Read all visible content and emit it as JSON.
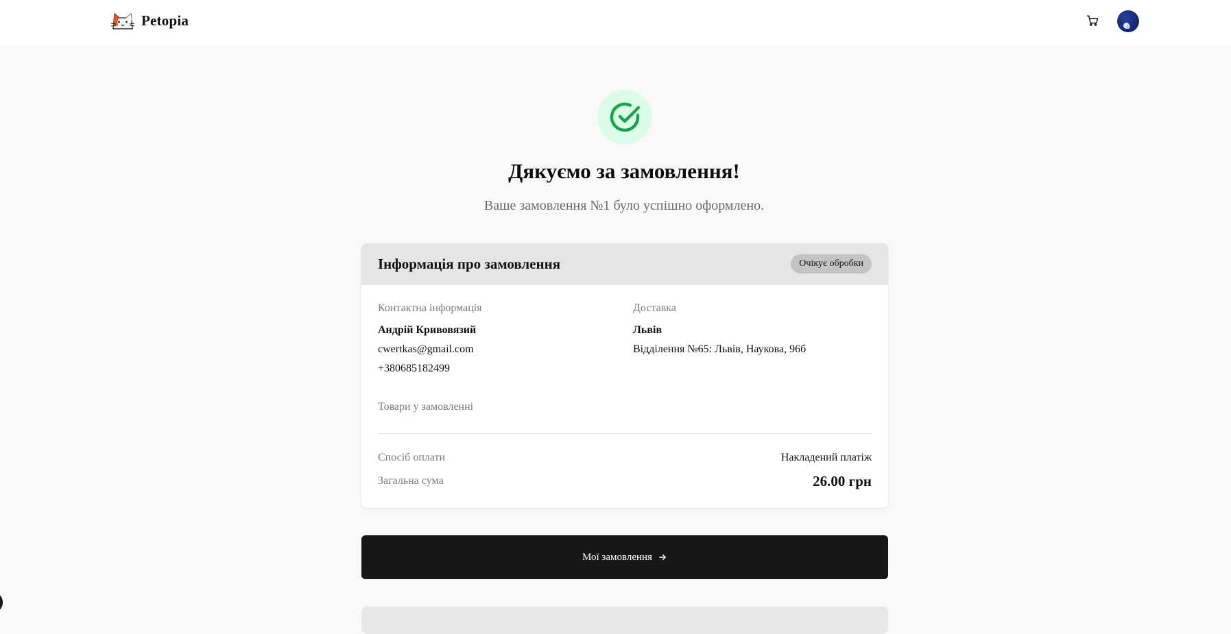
{
  "header": {
    "brand_name": "Petopia",
    "icons": {
      "logo": "cat-logo-icon",
      "cart": "cart-icon",
      "avatar": "user-avatar"
    }
  },
  "success": {
    "icon": "check-circle-icon",
    "accent_color": "#16a34a",
    "bg_color": "#dcfce7",
    "title": "Дякуємо за замовлення!",
    "subtitle": "Ваше замовлення №1 було успішно оформлено."
  },
  "order_card": {
    "title": "Інформація про замовлення",
    "status": "Очікує обробки",
    "contact": {
      "label": "Контактна інформація",
      "name": "Андрій Кривовязий",
      "email": "cwertkas@gmail.com",
      "phone": "+380685182499"
    },
    "delivery": {
      "label": "Доставка",
      "city": "Львів",
      "branch": "Відділення №65: Львів, Наукова, 96б"
    },
    "items_label": "Товари у замовленні",
    "payment": {
      "label": "Спосіб оплати",
      "value": "Накладений платіж"
    },
    "total": {
      "label": "Загальна сума",
      "value": "26.00 грн"
    }
  },
  "actions": {
    "my_orders_label": "Мої замовлення",
    "my_orders_icon": "arrow-right-icon"
  }
}
